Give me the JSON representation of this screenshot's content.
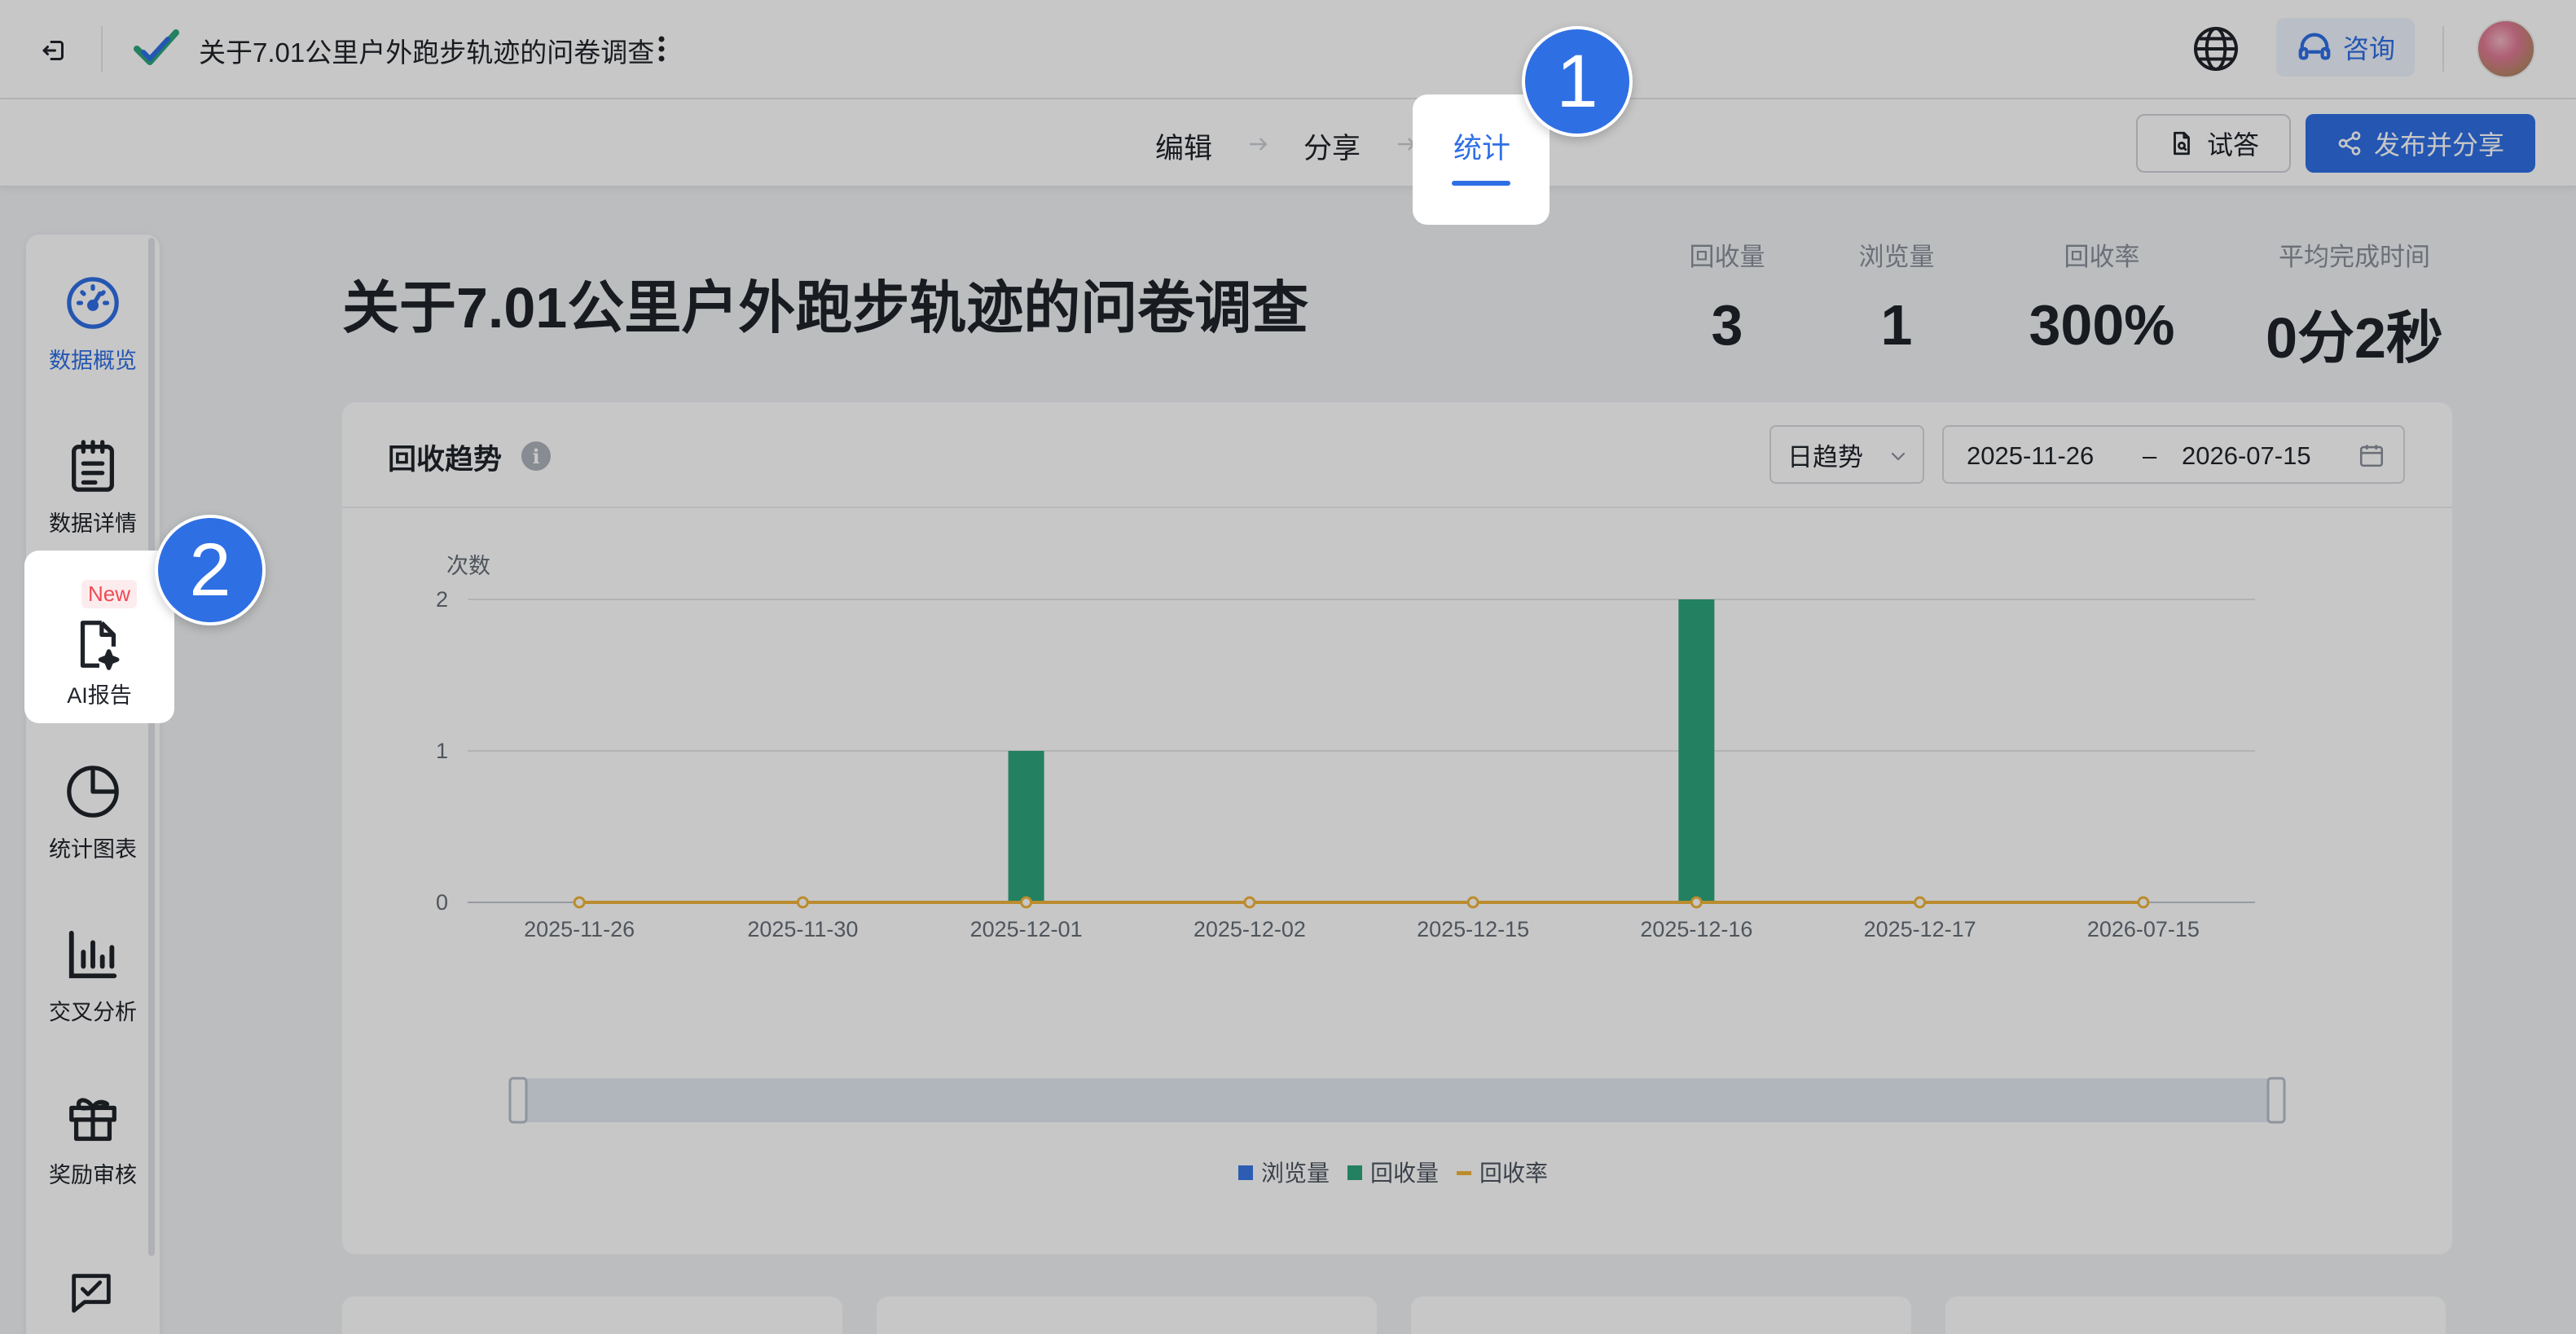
{
  "header": {
    "title": "关于7.01公里户外跑步轨迹的问卷调查",
    "consult_label": "咨询"
  },
  "tabs": {
    "items": [
      {
        "label": "编辑"
      },
      {
        "label": "分享"
      },
      {
        "label": "统计"
      }
    ],
    "active": "统计"
  },
  "actions": {
    "preview_label": "试答",
    "publish_label": "发布并分享"
  },
  "sidebar": {
    "items": [
      {
        "label": "数据概览",
        "icon": "gauge-icon",
        "active": true
      },
      {
        "label": "数据详情",
        "icon": "clipboard-icon"
      },
      {
        "label": "AI报告",
        "icon": "ai-report-icon",
        "badge": "New"
      },
      {
        "label": "统计图表",
        "icon": "pie-chart-icon"
      },
      {
        "label": "交叉分析",
        "icon": "bar-chart-icon"
      },
      {
        "label": "奖励审核",
        "icon": "gift-icon"
      }
    ]
  },
  "survey": {
    "title": "关于7.01公里户外跑步轨迹的问卷调查",
    "stats": [
      {
        "label": "回收量",
        "value": "3"
      },
      {
        "label": "浏览量",
        "value": "1"
      },
      {
        "label": "回收率",
        "value": "300%"
      },
      {
        "label": "平均完成时间",
        "value": "0分2秒"
      }
    ]
  },
  "trend": {
    "title": "回收趋势",
    "granularity": "日趋势",
    "date_start": "2025-11-26",
    "date_sep": "–",
    "date_end": "2026-07-15"
  },
  "steps": {
    "first": "1",
    "second": "2"
  },
  "colors": {
    "accent": "#2f6fe4",
    "views": "#3a78e6",
    "responses": "#2ea57b",
    "rate": "#f0b43c"
  },
  "chart_data": {
    "type": "bar",
    "ylabel": "次数",
    "categories": [
      "2025-11-26",
      "2025-11-30",
      "2025-12-01",
      "2025-12-02",
      "2025-12-15",
      "2025-12-16",
      "2025-12-17",
      "2026-07-15"
    ],
    "ylim": [
      0,
      2
    ],
    "yticks": [
      "0",
      "1",
      "2"
    ],
    "series": [
      {
        "name": "浏览量",
        "type": "bar",
        "values": [
          0,
          0,
          0,
          0,
          0,
          0,
          0,
          0
        ]
      },
      {
        "name": "回收量",
        "type": "bar",
        "values": [
          0,
          0,
          1,
          0,
          0,
          2,
          0,
          0
        ]
      },
      {
        "name": "回收率",
        "type": "line",
        "values": [
          0,
          0,
          0,
          0,
          0,
          0,
          0,
          0
        ]
      }
    ],
    "legend": "bottom-center",
    "grid": true
  }
}
